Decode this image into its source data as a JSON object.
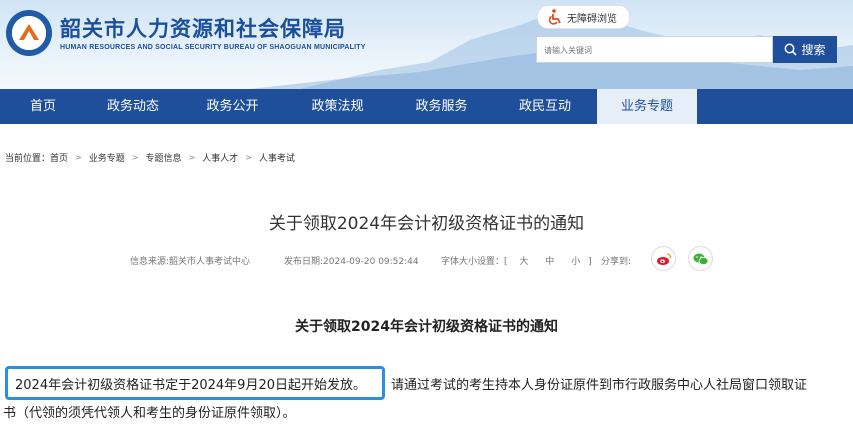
{
  "header": {
    "title": "韶关市人力资源和社会保障局",
    "subtitle": "HUMAN RESOURCES AND SOCIAL SECURITY BUREAU OF SHAOGUAN MUNICIPALITY",
    "accessibility_label": "无障碍浏览",
    "search_placeholder": "请输入关键词",
    "search_button": "搜索"
  },
  "nav": {
    "items": [
      "首页",
      "政务动态",
      "政务公开",
      "政策法规",
      "政务服务",
      "政民互动",
      "业务专题"
    ],
    "active_index": 6
  },
  "breadcrumb": {
    "prefix": "当前位置：",
    "items": [
      "首页",
      "业务专题",
      "专题信息",
      "人事人才",
      "人事考试"
    ]
  },
  "article": {
    "title": "关于领取2024年会计初级资格证书的通知",
    "source": "信息来源:韶关市人事考试中心",
    "date": "发布日期:2024-09-20 09:52:44",
    "font_size_label": "字体大小设置：",
    "font_open": "[",
    "font_large": "大",
    "font_medium": "中",
    "font_small": "小",
    "font_close": "]",
    "share_label": "分享到:",
    "content_title": "关于领取2024年会计初级资格证书的通知",
    "para_highlight": "2024年会计初级资格证书定于2024年9月20日起开始发放。",
    "para_rest_1": "请通过考试的考生持本人身份证原件到市行政服务中心人社局窗口领取证",
    "para_rest_2": "书（代领的须凭代领人和考生的身份证原件领取）。"
  },
  "colors": {
    "brand_blue": "#1f4f9a",
    "highlight": "#2a8fe0"
  }
}
